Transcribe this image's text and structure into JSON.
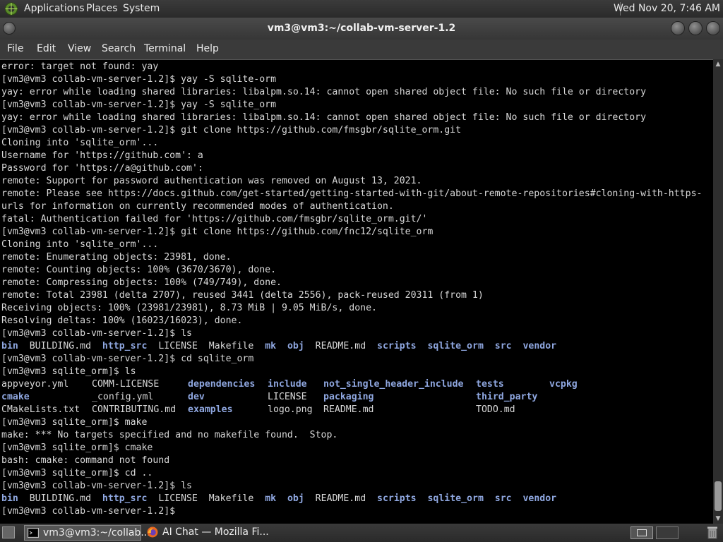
{
  "top_panel": {
    "menus": [
      "Applications",
      "Places",
      "System"
    ],
    "clock": "Wed Nov 20, 7:46 AM"
  },
  "window": {
    "title": "vm3@vm3:~/collab-vm-server-1.2"
  },
  "menu_bar": [
    "File",
    "Edit",
    "View",
    "Search",
    "Terminal",
    "Help"
  ],
  "terminal": {
    "lines": [
      "error: target not found: yay",
      "[vm3@vm3 collab-vm-server-1.2]$ yay -S sqlite-orm",
      "yay: error while loading shared libraries: libalpm.so.14: cannot open shared object file: No such file or directory",
      "[vm3@vm3 collab-vm-server-1.2]$ yay -S sqlite_orm",
      "yay: error while loading shared libraries: libalpm.so.14: cannot open shared object file: No such file or directory",
      "[vm3@vm3 collab-vm-server-1.2]$ git clone https://github.com/fmsgbr/sqlite_orm.git",
      "Cloning into 'sqlite_orm'...",
      "Username for 'https://github.com': a",
      "Password for 'https://a@github.com':",
      "remote: Support for password authentication was removed on August 13, 2021.",
      "remote: Please see https://docs.github.com/get-started/getting-started-with-git/about-remote-repositories#cloning-with-https-",
      "urls for information on currently recommended modes of authentication.",
      "fatal: Authentication failed for 'https://github.com/fmsgbr/sqlite_orm.git/'",
      "[vm3@vm3 collab-vm-server-1.2]$ git clone https://github.com/fnc12/sqlite_orm",
      "Cloning into 'sqlite_orm'...",
      "remote: Enumerating objects: 23981, done.",
      "remote: Counting objects: 100% (3670/3670), done.",
      "remote: Compressing objects: 100% (749/749), done.",
      "remote: Total 23981 (delta 2707), reused 3441 (delta 2556), pack-reused 20311 (from 1)",
      "Receiving objects: 100% (23981/23981), 8.73 MiB | 9.05 MiB/s, done.",
      "Resolving deltas: 100% (16023/16023), done.",
      "[vm3@vm3 collab-vm-server-1.2]$ ls"
    ],
    "ls1": [
      {
        "t": "bin",
        "d": true
      },
      {
        "t": "BUILDING.md",
        "d": false
      },
      {
        "t": "http_src",
        "d": true
      },
      {
        "t": "LICENSE",
        "d": false
      },
      {
        "t": "Makefile",
        "d": false
      },
      {
        "t": "mk",
        "d": true
      },
      {
        "t": "obj",
        "d": true
      },
      {
        "t": "README.md",
        "d": false
      },
      {
        "t": "scripts",
        "d": true
      },
      {
        "t": "sqlite_orm",
        "d": true
      },
      {
        "t": "src",
        "d": true
      },
      {
        "t": "vendor",
        "d": true
      }
    ],
    "lines2": [
      "[vm3@vm3 collab-vm-server-1.2]$ cd sqlite_orm",
      "[vm3@vm3 sqlite_orm]$ ls"
    ],
    "ls2": [
      [
        {
          "t": "appveyor.yml",
          "d": false
        },
        {
          "t": "COMM-LICENSE",
          "d": false
        },
        {
          "t": "dependencies",
          "d": true
        },
        {
          "t": "include",
          "d": true
        },
        {
          "t": "not_single_header_include",
          "d": true
        },
        {
          "t": "tests",
          "d": true
        },
        {
          "t": "vcpkg",
          "d": true
        }
      ],
      [
        {
          "t": "cmake",
          "d": true
        },
        {
          "t": "_config.yml",
          "d": false
        },
        {
          "t": "dev",
          "d": true
        },
        {
          "t": "LICENSE",
          "d": false
        },
        {
          "t": "packaging",
          "d": true
        },
        {
          "t": "third_party",
          "d": true
        },
        {
          "t": "",
          "d": false
        }
      ],
      [
        {
          "t": "CMakeLists.txt",
          "d": false
        },
        {
          "t": "CONTRIBUTING.md",
          "d": false
        },
        {
          "t": "examples",
          "d": true
        },
        {
          "t": "logo.png",
          "d": false
        },
        {
          "t": "README.md",
          "d": false
        },
        {
          "t": "TODO.md",
          "d": false
        },
        {
          "t": "",
          "d": false
        }
      ]
    ],
    "lines3": [
      "[vm3@vm3 sqlite_orm]$ make",
      "make: *** No targets specified and no makefile found.  Stop.",
      "[vm3@vm3 sqlite_orm]$ cmake",
      "bash: cmake: command not found",
      "[vm3@vm3 sqlite_orm]$ cd ..",
      "[vm3@vm3 collab-vm-server-1.2]$ ls"
    ],
    "ls3": [
      {
        "t": "bin",
        "d": true
      },
      {
        "t": "BUILDING.md",
        "d": false
      },
      {
        "t": "http_src",
        "d": true
      },
      {
        "t": "LICENSE",
        "d": false
      },
      {
        "t": "Makefile",
        "d": false
      },
      {
        "t": "mk",
        "d": true
      },
      {
        "t": "obj",
        "d": true
      },
      {
        "t": "README.md",
        "d": false
      },
      {
        "t": "scripts",
        "d": true
      },
      {
        "t": "sqlite_orm",
        "d": true
      },
      {
        "t": "src",
        "d": true
      },
      {
        "t": "vendor",
        "d": true
      }
    ],
    "prompt": "[vm3@vm3 collab-vm-server-1.2]$ "
  },
  "taskbar": {
    "tasks": [
      "vm3@vm3:~/collab...",
      "AI Chat — Mozilla Fi..."
    ]
  },
  "colors": {
    "directory": "#8fa7e0",
    "terminal_fg": "#d8d8d8",
    "terminal_bg": "#000000"
  },
  "icons": [
    "distro-logo-icon",
    "terminal-icon",
    "firefox-icon",
    "show-desktop-icon",
    "workspace-icon",
    "trash-icon"
  ]
}
